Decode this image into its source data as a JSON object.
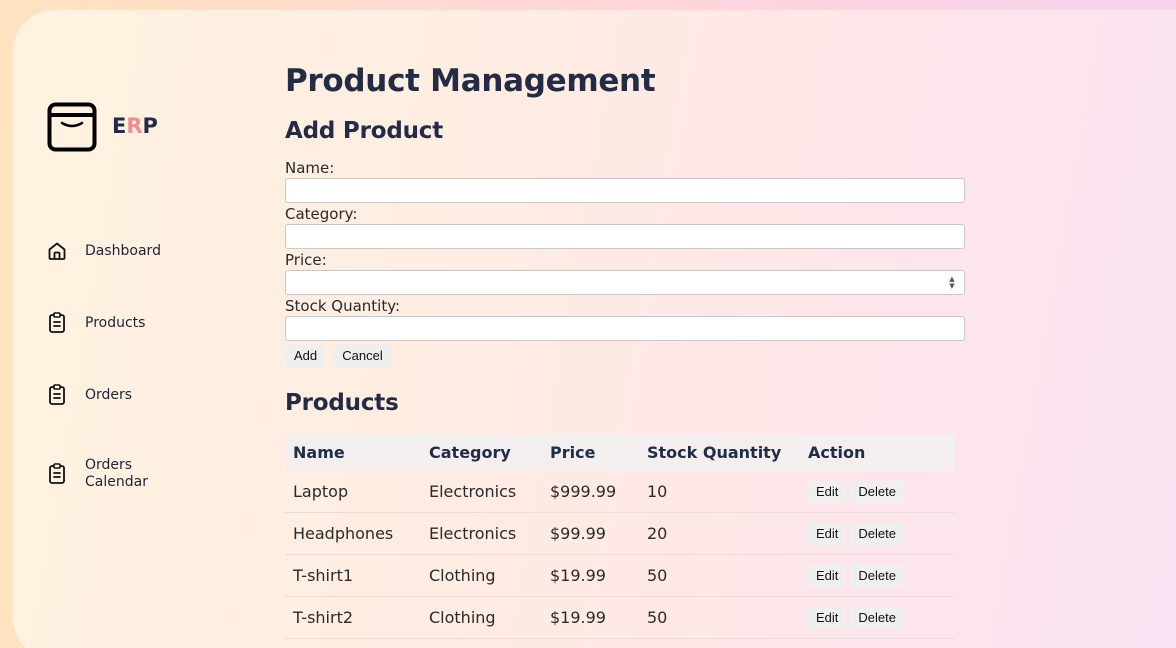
{
  "app": {
    "logo_letters": [
      "E",
      "R",
      "P"
    ]
  },
  "sidebar": {
    "items": [
      {
        "label": "Dashboard",
        "icon": "home-icon"
      },
      {
        "label": "Products",
        "icon": "clipboard-icon"
      },
      {
        "label": "Orders",
        "icon": "clipboard-icon"
      },
      {
        "label": "Orders Calendar",
        "icon": "clipboard-icon"
      }
    ]
  },
  "page": {
    "title": "Product Management"
  },
  "form": {
    "heading": "Add Product",
    "name_label": "Name:",
    "name_value": "",
    "category_label": "Category:",
    "category_value": "",
    "price_label": "Price:",
    "price_value": "",
    "stock_label": "Stock Quantity:",
    "stock_value": "",
    "add_label": "Add",
    "cancel_label": "Cancel"
  },
  "products": {
    "heading": "Products",
    "columns": [
      "Name",
      "Category",
      "Price",
      "Stock Quantity",
      "Action"
    ],
    "edit_label": "Edit",
    "delete_label": "Delete",
    "rows": [
      {
        "name": "Laptop",
        "category": "Electronics",
        "price": "$999.99",
        "stock": "10"
      },
      {
        "name": "Headphones",
        "category": "Electronics",
        "price": "$99.99",
        "stock": "20"
      },
      {
        "name": "T-shirt1",
        "category": "Clothing",
        "price": "$19.99",
        "stock": "50"
      },
      {
        "name": "T-shirt2",
        "category": "Clothing",
        "price": "$19.99",
        "stock": "50"
      }
    ]
  },
  "colors": {
    "heading": "#222c44",
    "logo_accent": "#f48a93"
  }
}
